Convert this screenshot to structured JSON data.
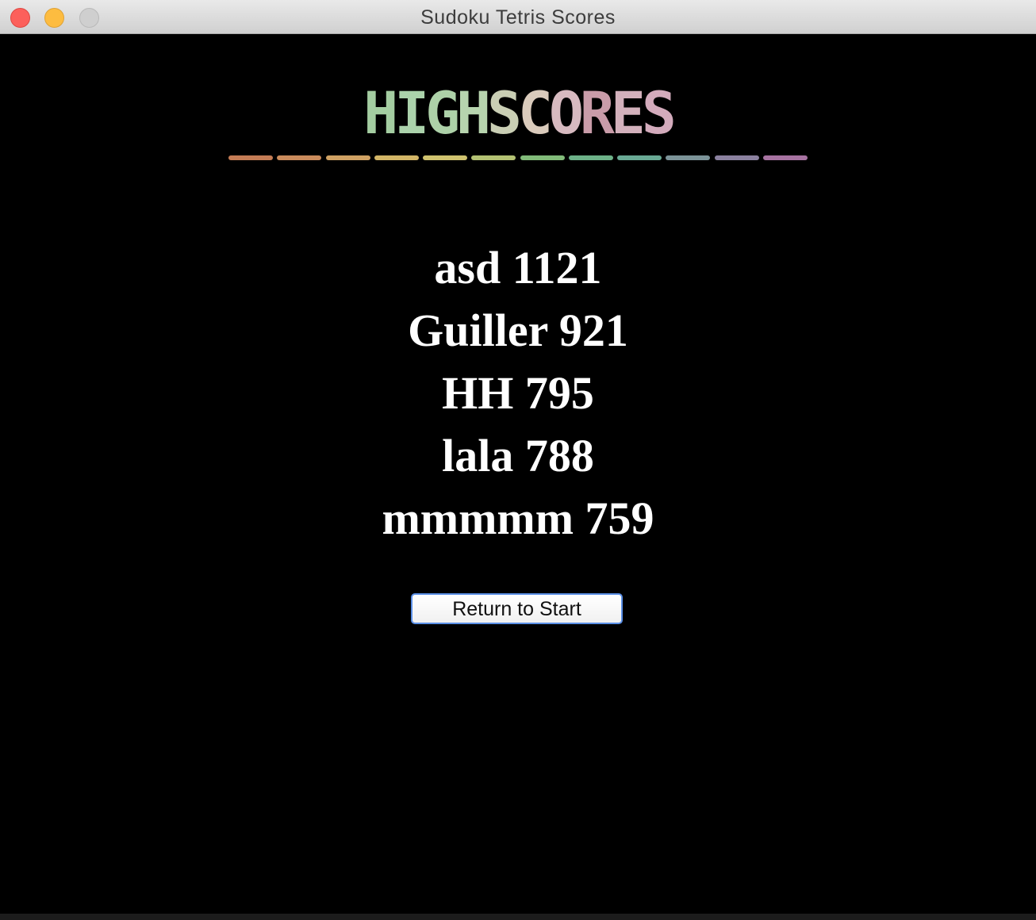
{
  "window": {
    "title": "Sudoku Tetris Scores"
  },
  "logo": {
    "text": "HIGHSCORES",
    "letter_colors": [
      "#9fcf9b",
      "#a6d4a6",
      "#a9d3a3",
      "#b3d6a9",
      "#c9cfb0",
      "#dccbb9",
      "#dbb9c0",
      "#cf9aa9",
      "#d8b0bd",
      "#d8a9bd"
    ],
    "bar_colors": [
      "#d98a5e",
      "#e09a66",
      "#e6b36e",
      "#e9c971",
      "#e5d77a",
      "#c7d67f",
      "#8fcf86",
      "#79c497",
      "#74bba4",
      "#8aa3a9",
      "#9a8fb0",
      "#b97fb3"
    ]
  },
  "scores": [
    "asd 1121",
    "Guiller 921",
    "HH 795",
    "lala 788",
    "mmmmm 759"
  ],
  "buttons": {
    "return_label": "Return to Start"
  }
}
